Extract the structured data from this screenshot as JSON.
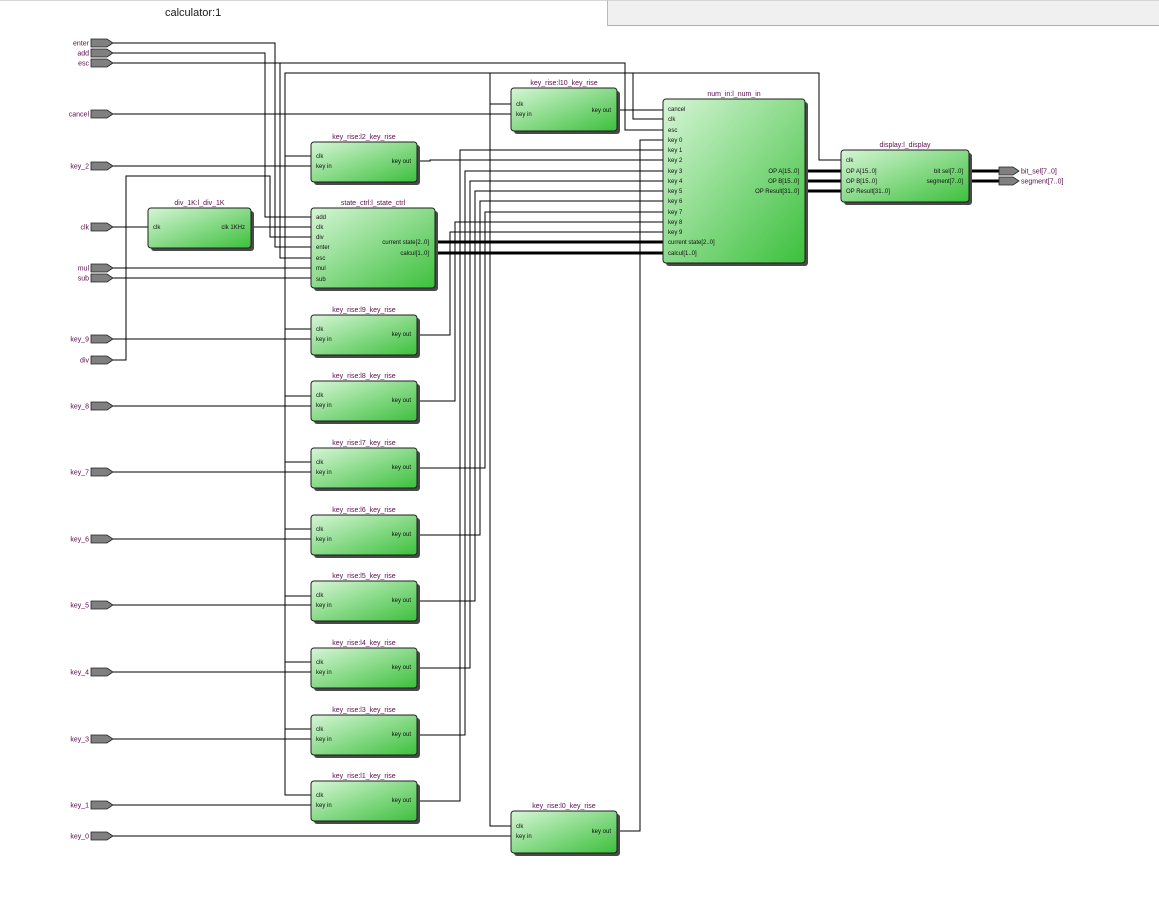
{
  "tab": {
    "title": "calculator:1"
  },
  "colors": {
    "block_light": "#d6f5d6",
    "block_dark": "#3cc03c",
    "pin": "#808080",
    "label": "#5c0a4c"
  },
  "pins": [
    {
      "id": "enter",
      "label": "enter",
      "icon": "input-pin-icon"
    },
    {
      "id": "add",
      "label": "add",
      "icon": "input-pin-icon"
    },
    {
      "id": "esc",
      "label": "esc",
      "icon": "input-pin-icon"
    },
    {
      "id": "cancel",
      "label": "cancel",
      "icon": "input-pin-icon"
    },
    {
      "id": "key_2",
      "label": "key_2",
      "icon": "input-pin-icon"
    },
    {
      "id": "clk",
      "label": "clk",
      "icon": "input-pin-icon"
    },
    {
      "id": "mul",
      "label": "mul",
      "icon": "input-pin-icon"
    },
    {
      "id": "sub",
      "label": "sub",
      "icon": "input-pin-icon"
    },
    {
      "id": "key_9",
      "label": "key_9",
      "icon": "input-pin-icon"
    },
    {
      "id": "div",
      "label": "div",
      "icon": "input-pin-icon"
    },
    {
      "id": "key_8",
      "label": "key_8",
      "icon": "input-pin-icon"
    },
    {
      "id": "key_7",
      "label": "key_7",
      "icon": "input-pin-icon"
    },
    {
      "id": "key_6",
      "label": "key_6",
      "icon": "input-pin-icon"
    },
    {
      "id": "key_5",
      "label": "key_5",
      "icon": "input-pin-icon"
    },
    {
      "id": "key_4",
      "label": "key_4",
      "icon": "input-pin-icon"
    },
    {
      "id": "key_3",
      "label": "key_3",
      "icon": "input-pin-icon"
    },
    {
      "id": "key_1",
      "label": "key_1",
      "icon": "input-pin-icon"
    },
    {
      "id": "key_0",
      "label": "key_0",
      "icon": "input-pin-icon"
    },
    {
      "id": "bit_sel",
      "label": "bit_sel[7..0]",
      "icon": "output-pin-icon"
    },
    {
      "id": "segment",
      "label": "segment[7..0]",
      "icon": "output-pin-icon"
    }
  ],
  "blocks": [
    {
      "id": "div1k",
      "title": "div_1K:l_div_1K",
      "inputs": [
        "clk"
      ],
      "outputs": [
        "clk_1KHz"
      ]
    },
    {
      "id": "kr2",
      "title": "key_rise:l2_key_rise",
      "inputs": [
        "clk",
        "key_in"
      ],
      "outputs": [
        "key_out"
      ]
    },
    {
      "id": "sc",
      "title": "state_ctrl:l_state_ctrl",
      "inputs": [
        "add",
        "clk",
        "div",
        "enter",
        "esc",
        "mul",
        "sub"
      ],
      "outputs": [
        "current_state[2..0]",
        "calcul[1..0]"
      ]
    },
    {
      "id": "kr10",
      "title": "key_rise:l10_key_rise",
      "inputs": [
        "clk",
        "key_in"
      ],
      "outputs": [
        "key_out"
      ]
    },
    {
      "id": "num",
      "title": "num_in:l_num_in",
      "inputs": [
        "cancel",
        "clk",
        "esc",
        "key_0",
        "key_1",
        "key_2",
        "key_3",
        "key_4",
        "key_5",
        "key_6",
        "key_7",
        "key_8",
        "key_9",
        "current_state[2..0]",
        "calcul[1..0]"
      ],
      "outputs": [
        "OP_A[15..0]",
        "OP_B[15..0]",
        "OP_Result[31..0]"
      ]
    },
    {
      "id": "disp",
      "title": "display:l_display",
      "inputs": [
        "clk",
        "OP_A[15..0]",
        "OP_B[15..0]",
        "OP_Result[31..0]"
      ],
      "outputs": [
        "bit_sel[7..0]",
        "segment[7..0]"
      ]
    },
    {
      "id": "kr9",
      "title": "key_rise:l9_key_rise",
      "inputs": [
        "clk",
        "key_in"
      ],
      "outputs": [
        "key_out"
      ]
    },
    {
      "id": "kr8",
      "title": "key_rise:l8_key_rise",
      "inputs": [
        "clk",
        "key_in"
      ],
      "outputs": [
        "key_out"
      ]
    },
    {
      "id": "kr7",
      "title": "key_rise:l7_key_rise",
      "inputs": [
        "clk",
        "key_in"
      ],
      "outputs": [
        "key_out"
      ]
    },
    {
      "id": "kr6",
      "title": "key_rise:l6_key_rise",
      "inputs": [
        "clk",
        "key_in"
      ],
      "outputs": [
        "key_out"
      ]
    },
    {
      "id": "kr5",
      "title": "key_rise:l5_key_rise",
      "inputs": [
        "clk",
        "key_in"
      ],
      "outputs": [
        "key_out"
      ]
    },
    {
      "id": "kr4",
      "title": "key_rise:l4_key_rise",
      "inputs": [
        "clk",
        "key_in"
      ],
      "outputs": [
        "key_out"
      ]
    },
    {
      "id": "kr3",
      "title": "key_rise:l3_key_rise",
      "inputs": [
        "clk",
        "key_in"
      ],
      "outputs": [
        "key_out"
      ]
    },
    {
      "id": "kr1",
      "title": "key_rise:l1_key_rise",
      "inputs": [
        "clk",
        "key_in"
      ],
      "outputs": [
        "key_out"
      ]
    },
    {
      "id": "kr0",
      "title": "key_rise:l0_key_rise",
      "inputs": [
        "clk",
        "key_in"
      ],
      "outputs": [
        "key_out"
      ]
    }
  ]
}
